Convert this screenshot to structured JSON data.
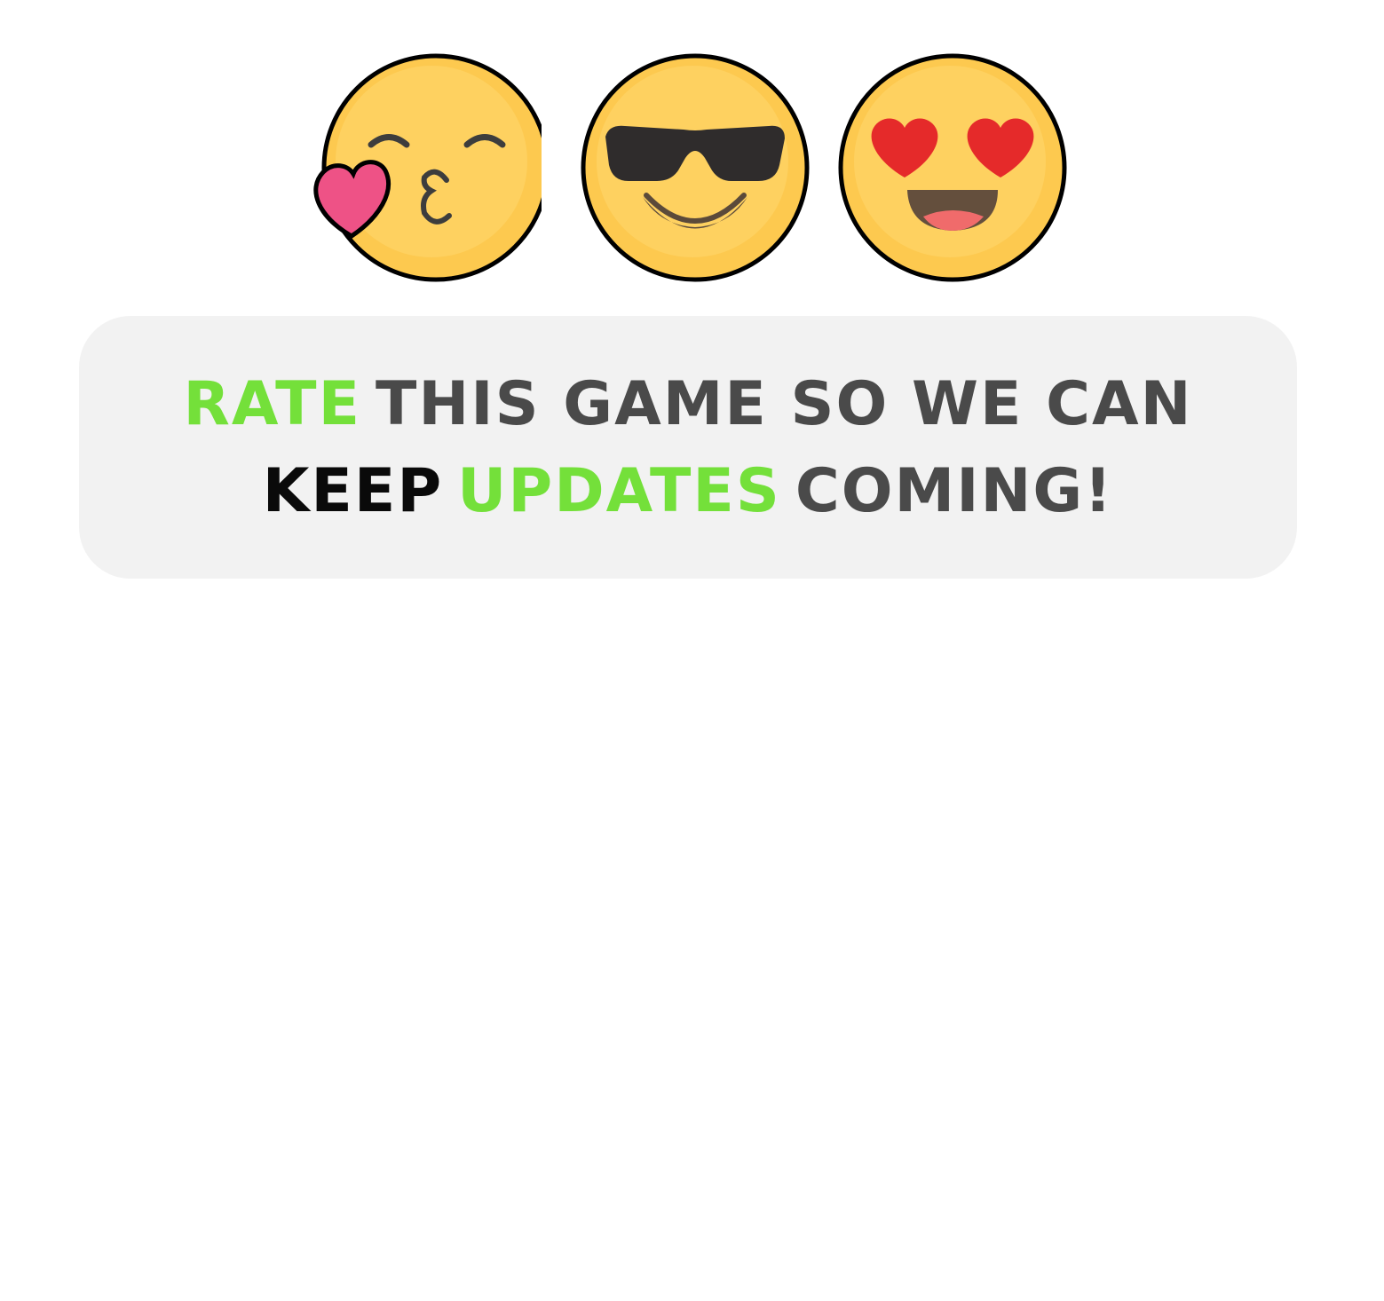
{
  "emojis": [
    {
      "name": "kissing-face-with-heart-icon"
    },
    {
      "name": "smiling-face-with-sunglasses-icon"
    },
    {
      "name": "heart-eyes-face-icon"
    }
  ],
  "banner": {
    "line1": {
      "word1": "RATE",
      "word2": "THIS GAME SO WE CAN"
    },
    "line2": {
      "word1": "KEEP",
      "word2": "UPDATES",
      "word3": "COMING!"
    }
  },
  "colors": {
    "highlight": "#74e03a",
    "text_gray": "#4a4a4a",
    "text_black": "#0a0a0a",
    "banner_bg": "#f2f2f2",
    "emoji_yellow": "#fdc94f",
    "heart_pink": "#ee5286",
    "heart_red": "#e52a2a"
  }
}
